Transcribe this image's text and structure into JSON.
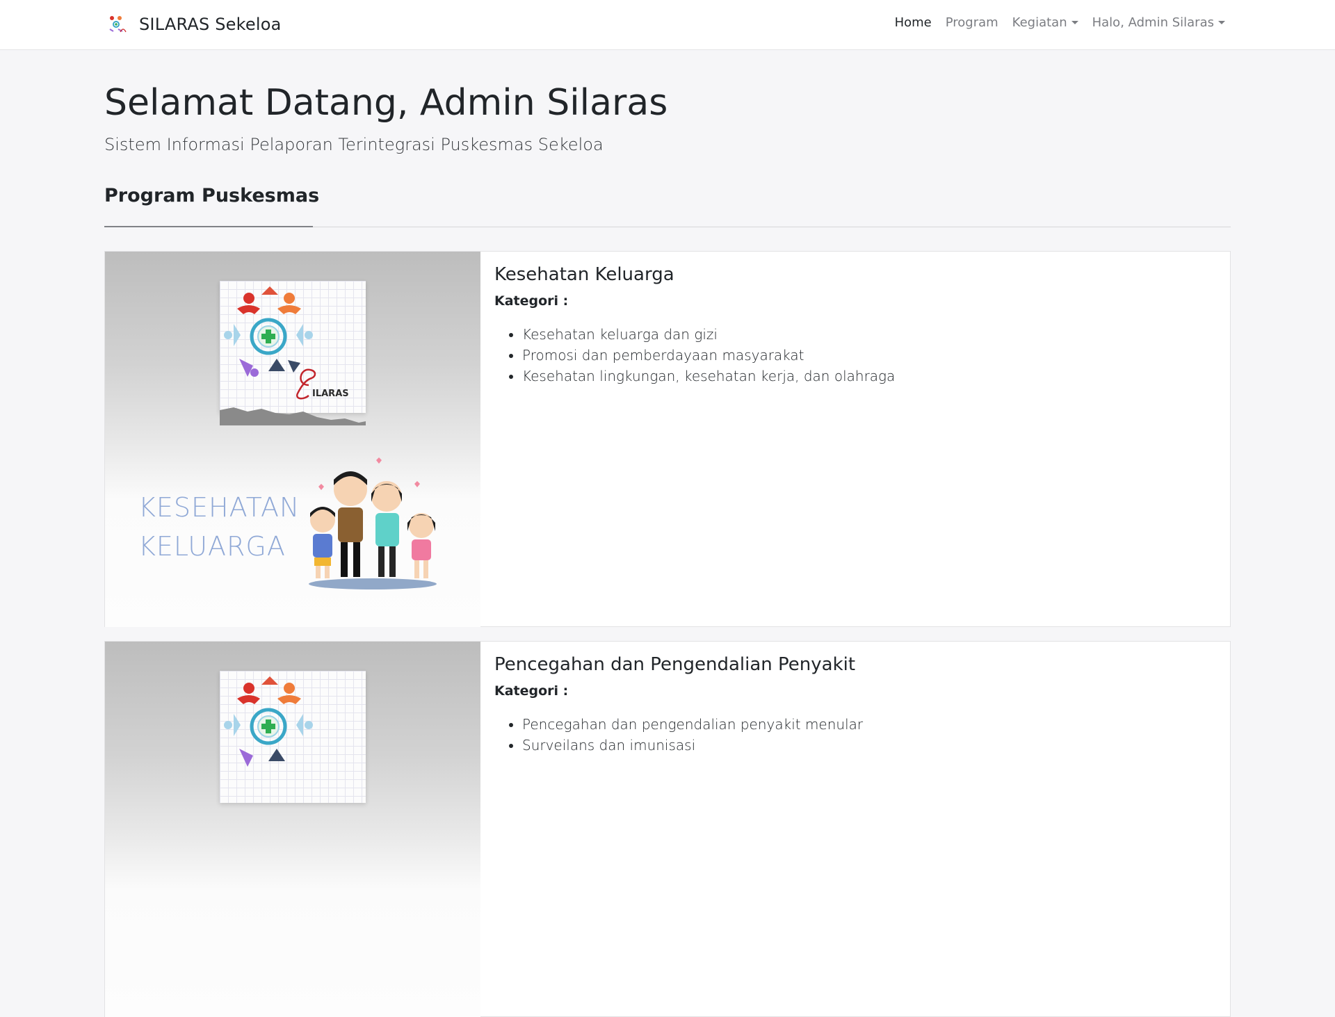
{
  "navbar": {
    "brand": "SILARAS Sekeloa",
    "items": [
      {
        "label": "Home",
        "active": true,
        "dropdown": false
      },
      {
        "label": "Program",
        "active": false,
        "dropdown": false
      },
      {
        "label": "Kegiatan",
        "active": false,
        "dropdown": true
      },
      {
        "label": "Halo, Admin Silaras",
        "active": false,
        "dropdown": true
      }
    ]
  },
  "hero": {
    "title": "Selamat Datang, Admin Silaras",
    "subtitle": "Sistem Informasi Pelaporan Terintegrasi Puskesmas Sekeloa"
  },
  "section": {
    "title": "Program Puskesmas"
  },
  "programs": [
    {
      "title": "Kesehatan Keluarga",
      "kategori_label": "Kategori :",
      "image_logo_text": "ILARAS",
      "image_caption_line1": "KESEHATAN",
      "image_caption_line2": "KELUARGA",
      "categories": [
        "Kesehatan keluarga dan gizi",
        "Promosi dan pemberdayaan masyarakat",
        "Kesehatan lingkungan, kesehatan kerja, dan olahraga"
      ]
    },
    {
      "title": "Pencegahan dan Pengendalian Penyakit",
      "kategori_label": "Kategori :",
      "categories": [
        "Pencegahan dan pengendalian penyakit menular",
        "Surveilans dan imunisasi"
      ]
    }
  ],
  "colors": {
    "accent_red": "#d9332b",
    "accent_orange": "#ef7c3a",
    "accent_purple": "#9b6ad8",
    "accent_teal": "#3aa7c7"
  }
}
